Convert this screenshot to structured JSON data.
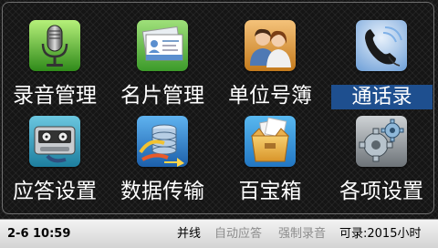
{
  "menu": [
    {
      "label": "录音管理",
      "icon": "microphone-icon"
    },
    {
      "label": "名片管理",
      "icon": "business-cards-icon"
    },
    {
      "label": "单位号簿",
      "icon": "contacts-icon"
    },
    {
      "label": "通话录",
      "icon": "phone-handset-icon",
      "selected": true
    },
    {
      "label": "应答设置",
      "icon": "answering-machine-icon"
    },
    {
      "label": "数据传输",
      "icon": "data-transfer-icon"
    },
    {
      "label": "百宝箱",
      "icon": "toolbox-icon"
    },
    {
      "label": "各项设置",
      "icon": "settings-gears-icon"
    }
  ],
  "status": {
    "datetime": "2-6  10:59",
    "line": "并线",
    "auto_answer": "自动应答",
    "force_record": "强制录音",
    "recordable": "可录:2015小时"
  },
  "colors": {
    "selected_label_bg": "#1e4f8f",
    "statusbar_bg": "#e6e6e6",
    "inactive_status_text": "#8c8c8c"
  }
}
